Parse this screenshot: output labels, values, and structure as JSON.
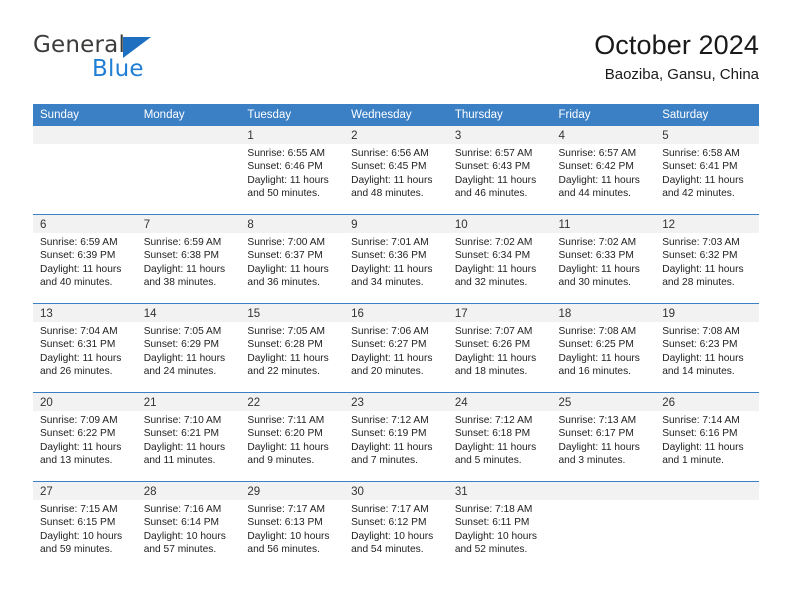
{
  "brand": {
    "name_part1": "General",
    "name_part2": "Blue",
    "accent_color": "#1f7fd4",
    "triangle_color": "#1f6fc0"
  },
  "header": {
    "title": "October 2024",
    "subtitle": "Baoziba, Gansu, China"
  },
  "theme": {
    "header_bg": "#3b7fc4",
    "daynum_bg": "#f2f2f2",
    "separator": "#3b7fc4"
  },
  "weekdays": [
    "Sunday",
    "Monday",
    "Tuesday",
    "Wednesday",
    "Thursday",
    "Friday",
    "Saturday"
  ],
  "weeks": [
    [
      {
        "day": "",
        "sunrise": "",
        "sunset": "",
        "daylight1": "",
        "daylight2": ""
      },
      {
        "day": "",
        "sunrise": "",
        "sunset": "",
        "daylight1": "",
        "daylight2": ""
      },
      {
        "day": "1",
        "sunrise": "Sunrise: 6:55 AM",
        "sunset": "Sunset: 6:46 PM",
        "daylight1": "Daylight: 11 hours",
        "daylight2": "and 50 minutes."
      },
      {
        "day": "2",
        "sunrise": "Sunrise: 6:56 AM",
        "sunset": "Sunset: 6:45 PM",
        "daylight1": "Daylight: 11 hours",
        "daylight2": "and 48 minutes."
      },
      {
        "day": "3",
        "sunrise": "Sunrise: 6:57 AM",
        "sunset": "Sunset: 6:43 PM",
        "daylight1": "Daylight: 11 hours",
        "daylight2": "and 46 minutes."
      },
      {
        "day": "4",
        "sunrise": "Sunrise: 6:57 AM",
        "sunset": "Sunset: 6:42 PM",
        "daylight1": "Daylight: 11 hours",
        "daylight2": "and 44 minutes."
      },
      {
        "day": "5",
        "sunrise": "Sunrise: 6:58 AM",
        "sunset": "Sunset: 6:41 PM",
        "daylight1": "Daylight: 11 hours",
        "daylight2": "and 42 minutes."
      }
    ],
    [
      {
        "day": "6",
        "sunrise": "Sunrise: 6:59 AM",
        "sunset": "Sunset: 6:39 PM",
        "daylight1": "Daylight: 11 hours",
        "daylight2": "and 40 minutes."
      },
      {
        "day": "7",
        "sunrise": "Sunrise: 6:59 AM",
        "sunset": "Sunset: 6:38 PM",
        "daylight1": "Daylight: 11 hours",
        "daylight2": "and 38 minutes."
      },
      {
        "day": "8",
        "sunrise": "Sunrise: 7:00 AM",
        "sunset": "Sunset: 6:37 PM",
        "daylight1": "Daylight: 11 hours",
        "daylight2": "and 36 minutes."
      },
      {
        "day": "9",
        "sunrise": "Sunrise: 7:01 AM",
        "sunset": "Sunset: 6:36 PM",
        "daylight1": "Daylight: 11 hours",
        "daylight2": "and 34 minutes."
      },
      {
        "day": "10",
        "sunrise": "Sunrise: 7:02 AM",
        "sunset": "Sunset: 6:34 PM",
        "daylight1": "Daylight: 11 hours",
        "daylight2": "and 32 minutes."
      },
      {
        "day": "11",
        "sunrise": "Sunrise: 7:02 AM",
        "sunset": "Sunset: 6:33 PM",
        "daylight1": "Daylight: 11 hours",
        "daylight2": "and 30 minutes."
      },
      {
        "day": "12",
        "sunrise": "Sunrise: 7:03 AM",
        "sunset": "Sunset: 6:32 PM",
        "daylight1": "Daylight: 11 hours",
        "daylight2": "and 28 minutes."
      }
    ],
    [
      {
        "day": "13",
        "sunrise": "Sunrise: 7:04 AM",
        "sunset": "Sunset: 6:31 PM",
        "daylight1": "Daylight: 11 hours",
        "daylight2": "and 26 minutes."
      },
      {
        "day": "14",
        "sunrise": "Sunrise: 7:05 AM",
        "sunset": "Sunset: 6:29 PM",
        "daylight1": "Daylight: 11 hours",
        "daylight2": "and 24 minutes."
      },
      {
        "day": "15",
        "sunrise": "Sunrise: 7:05 AM",
        "sunset": "Sunset: 6:28 PM",
        "daylight1": "Daylight: 11 hours",
        "daylight2": "and 22 minutes."
      },
      {
        "day": "16",
        "sunrise": "Sunrise: 7:06 AM",
        "sunset": "Sunset: 6:27 PM",
        "daylight1": "Daylight: 11 hours",
        "daylight2": "and 20 minutes."
      },
      {
        "day": "17",
        "sunrise": "Sunrise: 7:07 AM",
        "sunset": "Sunset: 6:26 PM",
        "daylight1": "Daylight: 11 hours",
        "daylight2": "and 18 minutes."
      },
      {
        "day": "18",
        "sunrise": "Sunrise: 7:08 AM",
        "sunset": "Sunset: 6:25 PM",
        "daylight1": "Daylight: 11 hours",
        "daylight2": "and 16 minutes."
      },
      {
        "day": "19",
        "sunrise": "Sunrise: 7:08 AM",
        "sunset": "Sunset: 6:23 PM",
        "daylight1": "Daylight: 11 hours",
        "daylight2": "and 14 minutes."
      }
    ],
    [
      {
        "day": "20",
        "sunrise": "Sunrise: 7:09 AM",
        "sunset": "Sunset: 6:22 PM",
        "daylight1": "Daylight: 11 hours",
        "daylight2": "and 13 minutes."
      },
      {
        "day": "21",
        "sunrise": "Sunrise: 7:10 AM",
        "sunset": "Sunset: 6:21 PM",
        "daylight1": "Daylight: 11 hours",
        "daylight2": "and 11 minutes."
      },
      {
        "day": "22",
        "sunrise": "Sunrise: 7:11 AM",
        "sunset": "Sunset: 6:20 PM",
        "daylight1": "Daylight: 11 hours",
        "daylight2": "and 9 minutes."
      },
      {
        "day": "23",
        "sunrise": "Sunrise: 7:12 AM",
        "sunset": "Sunset: 6:19 PM",
        "daylight1": "Daylight: 11 hours",
        "daylight2": "and 7 minutes."
      },
      {
        "day": "24",
        "sunrise": "Sunrise: 7:12 AM",
        "sunset": "Sunset: 6:18 PM",
        "daylight1": "Daylight: 11 hours",
        "daylight2": "and 5 minutes."
      },
      {
        "day": "25",
        "sunrise": "Sunrise: 7:13 AM",
        "sunset": "Sunset: 6:17 PM",
        "daylight1": "Daylight: 11 hours",
        "daylight2": "and 3 minutes."
      },
      {
        "day": "26",
        "sunrise": "Sunrise: 7:14 AM",
        "sunset": "Sunset: 6:16 PM",
        "daylight1": "Daylight: 11 hours",
        "daylight2": "and 1 minute."
      }
    ],
    [
      {
        "day": "27",
        "sunrise": "Sunrise: 7:15 AM",
        "sunset": "Sunset: 6:15 PM",
        "daylight1": "Daylight: 10 hours",
        "daylight2": "and 59 minutes."
      },
      {
        "day": "28",
        "sunrise": "Sunrise: 7:16 AM",
        "sunset": "Sunset: 6:14 PM",
        "daylight1": "Daylight: 10 hours",
        "daylight2": "and 57 minutes."
      },
      {
        "day": "29",
        "sunrise": "Sunrise: 7:17 AM",
        "sunset": "Sunset: 6:13 PM",
        "daylight1": "Daylight: 10 hours",
        "daylight2": "and 56 minutes."
      },
      {
        "day": "30",
        "sunrise": "Sunrise: 7:17 AM",
        "sunset": "Sunset: 6:12 PM",
        "daylight1": "Daylight: 10 hours",
        "daylight2": "and 54 minutes."
      },
      {
        "day": "31",
        "sunrise": "Sunrise: 7:18 AM",
        "sunset": "Sunset: 6:11 PM",
        "daylight1": "Daylight: 10 hours",
        "daylight2": "and 52 minutes."
      },
      {
        "day": "",
        "sunrise": "",
        "sunset": "",
        "daylight1": "",
        "daylight2": ""
      },
      {
        "day": "",
        "sunrise": "",
        "sunset": "",
        "daylight1": "",
        "daylight2": ""
      }
    ]
  ]
}
